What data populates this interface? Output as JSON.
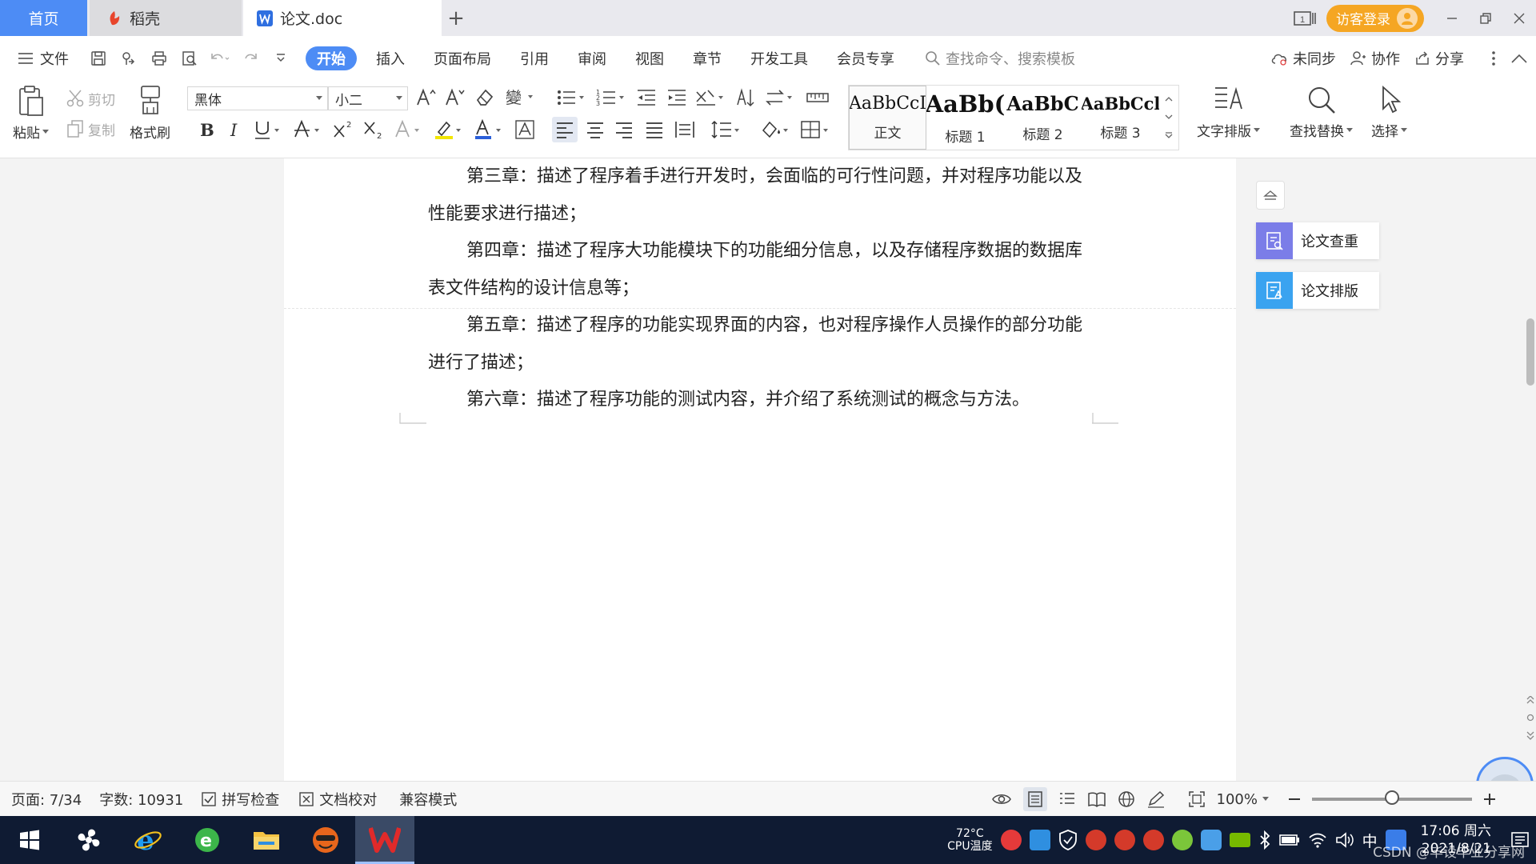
{
  "tabs": {
    "home": "首页",
    "daoke": "稻壳",
    "doc": "论文.doc",
    "new_tab": "+"
  },
  "titlebar": {
    "visitor_login": "访客登录"
  },
  "menu": {
    "file": "文件",
    "items": [
      "开始",
      "插入",
      "页面布局",
      "引用",
      "审阅",
      "视图",
      "章节",
      "开发工具",
      "会员专享"
    ],
    "search_placeholder": "查找命令、搜索模板",
    "unsynced": "未同步",
    "collab": "协作",
    "share": "分享"
  },
  "ribbon": {
    "paste": "粘贴",
    "cut": "剪切",
    "copy": "复制",
    "format_painter": "格式刷",
    "font_name": "黑体",
    "font_size": "小二",
    "styles": [
      {
        "sample": "AaBbCcI",
        "label": "正文"
      },
      {
        "sample": "AaBb(",
        "label": "标题 1"
      },
      {
        "sample": "AaBbC",
        "label": "标题 2"
      },
      {
        "sample": "AaBbCcl",
        "label": "标题 3"
      }
    ],
    "text_layout": "文字排版",
    "find_replace": "查找替换",
    "select": "选择"
  },
  "document": {
    "paragraphs": [
      "第三章：描述了程序着手进行开发时，会面临的可行性问题，并对程序功能以及性能要求进行描述；",
      "第四章：描述了程序大功能模块下的功能细分信息，以及存储程序数据的数据库表文件结构的设计信息等；",
      "第五章：描述了程序的功能实现界面的内容，也对程序操作人员操作的部分功能进行了描述；",
      "第六章：描述了程序功能的测试内容，并介绍了系统测试的概念与方法。"
    ]
  },
  "assist_panel": {
    "check": "论文查重",
    "layout": "论文排版"
  },
  "status": {
    "page": "页面: 7/34",
    "word_count": "字数: 10931",
    "spell_check": "拼写检查",
    "doc_proof": "文档校对",
    "compat_mode": "兼容模式",
    "zoom": "100%",
    "zoom_fraction": 0.5
  },
  "taskbar": {
    "cpu_temp_value": "72°C",
    "cpu_temp_label": "CPU温度",
    "ime": "中",
    "time": "17:06 周六",
    "date": "2021/8/21",
    "watermark": "CSDN @毕设毕业分享网"
  },
  "colors": {
    "accent": "#4d8cf5",
    "visitor": "#f5a623",
    "taskbar": "#0f1b33"
  }
}
